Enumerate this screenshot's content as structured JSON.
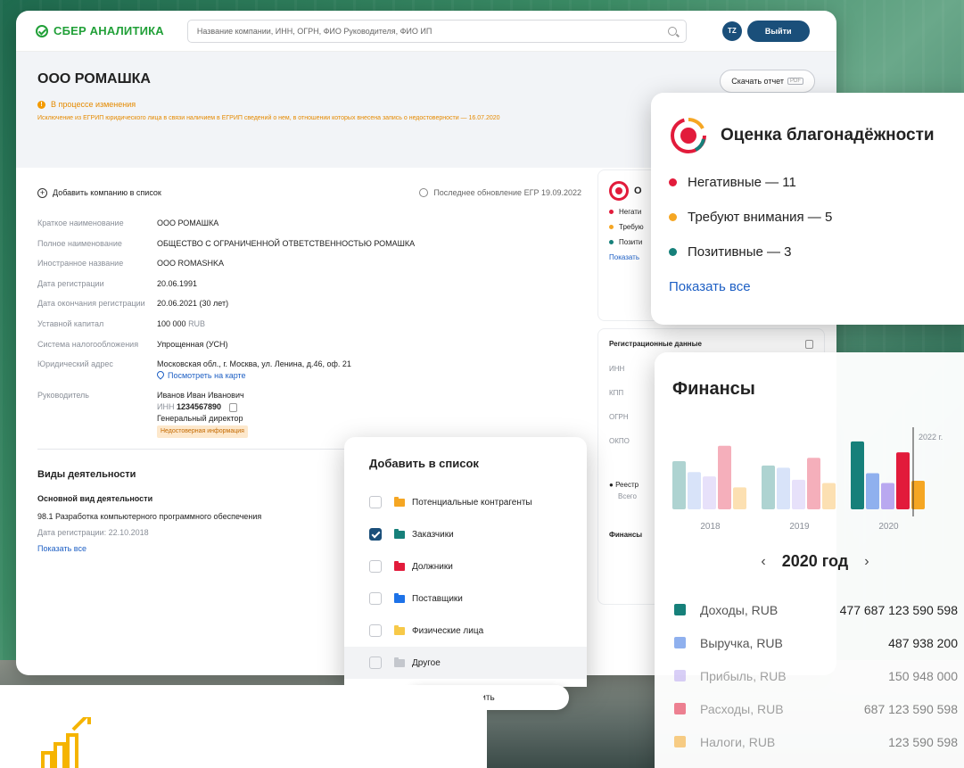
{
  "brand": {
    "logo_text": "СБЕР АНАЛИТИКА",
    "accent": "#21a038",
    "primary": "#1a4f7a"
  },
  "topbar": {
    "search_placeholder": "Название компании, ИНН, ОГРН, ФИО Руководителя, ФИО ИП",
    "avatar_initials": "TZ",
    "logout_label": "Выйти"
  },
  "company": {
    "title": "ООО РОМАШКА",
    "download_label": "Скачать отчет",
    "pdf_label": "PDF",
    "status_text": "В процессе изменения",
    "notice": "Исключение из ЕГРИП юридического лица в связи наличием в ЕГРИП сведений о нем, в отношении которых внесена запись о недостоверности — 16.07.2020"
  },
  "actions": {
    "add_to_list": "Добавить компанию в список",
    "last_update": "Последнее обновление ЕГР 19.09.2022"
  },
  "details": {
    "short_name_label": "Краткое наименование",
    "short_name": "ООО РОМАШКА",
    "full_name_label": "Полное наименование",
    "full_name": "ОБЩЕСТВО С ОГРАНИЧЕННОЙ ОТВЕТСТВЕННОСТЬЮ РОМАШКА",
    "foreign_name_label": "Иностранное название",
    "foreign_name": "OOO ROMASHKA",
    "reg_date_label": "Дата регистрации",
    "reg_date": "20.06.1991",
    "end_date_label": "Дата окончания регистрации",
    "end_date": "20.06.2021 (30 лет)",
    "capital_label": "Уставной капитал",
    "capital_value": "100 000",
    "capital_currency": "RUB",
    "tax_label": "Система налогообложения",
    "tax_value": "Упрощенная (УСН)",
    "address_label": "Юридический адрес",
    "address_value": "Московская обл., г. Москва, ул. Ленина, д.46, оф. 21",
    "map_link": "Посмотреть на карте",
    "head_label": "Руководитель",
    "head_name": "Иванов Иван Иванович",
    "head_inn_prefix": "ИНН",
    "head_inn": "1234567890",
    "head_position": "Генеральный директор",
    "head_badge": "Недостоверная информация"
  },
  "activities": {
    "title": "Виды деятельности",
    "main_title": "Основной вид деятельности",
    "main_value": "98.1 Разработка компьютерного программного обеспечения",
    "main_date": "Дата регистрации: 22.10.2018",
    "show_all": "Показать все"
  },
  "right_col": {
    "rel_short": "О",
    "neg_short": "Негати",
    "attn_short": "Требую",
    "pos_short": "Позити",
    "show_short": "Показать",
    "reg_title": "Регистрационные данные",
    "inn": "ИНН",
    "kpp": "КПП",
    "ogrn": "ОГРН",
    "okpo": "ОКПО",
    "registry": "Реестр",
    "total": "Всего",
    "finance_short": "Финансы"
  },
  "reliability": {
    "title": "Оценка благонадёжности",
    "items": [
      {
        "label": "Негативные — 11",
        "color": "#e21b3b"
      },
      {
        "label": "Требуют внимания — 5",
        "color": "#f5a623"
      },
      {
        "label": "Позитивные — 3",
        "color": "#16807a"
      }
    ],
    "show_all": "Показать все"
  },
  "finance": {
    "title": "Финансы",
    "year_label": "2020 год",
    "hover_label": "2022 г.",
    "rows": [
      {
        "name": "Доходы, RUB",
        "value": "477 687 123 590 598",
        "color": "#16807a"
      },
      {
        "name": "Выручка, RUB",
        "value": "487 938 200",
        "color": "#8fb0ee"
      },
      {
        "name": "Прибыль, RUB",
        "value": "150 948 000",
        "color": "#b9a8f0"
      },
      {
        "name": "Расходы, RUB",
        "value": "687 123 590 598",
        "color": "#e21b3b"
      },
      {
        "name": "Налоги, RUB",
        "value": "123 590 598",
        "color": "#f5a623"
      }
    ]
  },
  "chart_data": {
    "type": "bar",
    "categories": [
      "2018",
      "2019",
      "2020"
    ],
    "series": [
      {
        "name": "Доходы, RUB",
        "values": [
          44,
          40,
          62
        ]
      },
      {
        "name": "Выручка, RUB",
        "values": [
          34,
          38,
          33
        ]
      },
      {
        "name": "Прибыль, RUB",
        "values": [
          30,
          27,
          24
        ]
      },
      {
        "name": "Расходы, RUB",
        "values": [
          58,
          47,
          52
        ]
      },
      {
        "name": "Налоги, RUB",
        "values": [
          20,
          24,
          26
        ]
      }
    ],
    "ylim": [
      0,
      70
    ],
    "grid": false
  },
  "add_list": {
    "title": "Добавить в список",
    "items": [
      {
        "label": "Потенциальные контрагенты",
        "checked": false,
        "color": "#f5a623"
      },
      {
        "label": "Заказчики",
        "checked": true,
        "color": "#16807a"
      },
      {
        "label": "Должники",
        "checked": false,
        "color": "#e21b3b"
      },
      {
        "label": "Поставщики",
        "checked": false,
        "color": "#1d72e8"
      },
      {
        "label": "Физические лица",
        "checked": false,
        "color": "#f7c948"
      },
      {
        "label": "Другое",
        "checked": false,
        "color": "#c4c7cd"
      }
    ],
    "save_partial": "ить"
  }
}
